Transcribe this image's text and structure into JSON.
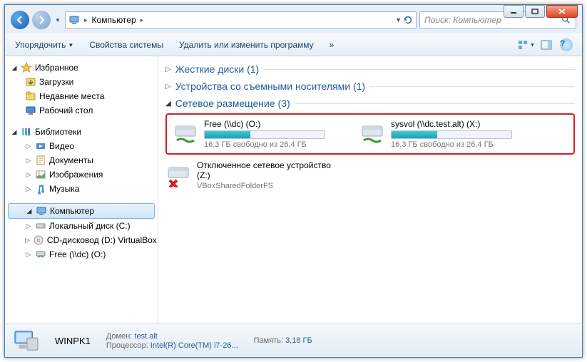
{
  "window": {
    "minimize": "—",
    "maximize": "❐",
    "close": "✕"
  },
  "address": {
    "crumb": "Компьютер",
    "crumb_arrow": "▶"
  },
  "search": {
    "placeholder": "Поиск: Компьютер"
  },
  "toolbar": {
    "organize": "Упорядочить",
    "properties": "Свойства системы",
    "uninstall": "Удалить или изменить программу",
    "more": "»"
  },
  "sidebar": {
    "favorites": "Избранное",
    "downloads": "Загрузки",
    "recent": "Недавние места",
    "desktop": "Рабочий стол",
    "libraries": "Библиотеки",
    "video": "Видео",
    "documents": "Документы",
    "pictures": "Изображения",
    "music": "Музыка",
    "computer": "Компьютер",
    "local_c": "Локальный диск (C:)",
    "cd_d": "CD-дисковод (D:) VirtualBox",
    "free_o": "Free (\\\\dc) (O:)"
  },
  "groups": {
    "hdd": {
      "label": "Жесткие диски (1)"
    },
    "removable": {
      "label": "Устройства со съемными носителями (1)"
    },
    "network": {
      "label": "Сетевое размещение (3)"
    }
  },
  "drives": {
    "free": {
      "name": "Free (\\\\dc) (O:)",
      "sub": "16,3 ГБ свободно из 26,4 ГБ",
      "percent": 38
    },
    "sysvol": {
      "name": "sysvol (\\\\dc.test.alt) (X:)",
      "sub": "16,3 ГБ свободно из 26,4 ГБ",
      "percent": 38
    },
    "disconnected": {
      "name": "Отключенное сетевое устройство (Z:)",
      "sub": "VBoxSharedFolderFS"
    }
  },
  "status": {
    "pc_name": "WINPK1",
    "domain_lbl": "Домен:",
    "domain_val": "test.alt",
    "cpu_lbl": "Процессор:",
    "cpu_val": "Intel(R) Core(TM) i7-26...",
    "mem_lbl": "Память:",
    "mem_val": "3,18 ГБ"
  }
}
